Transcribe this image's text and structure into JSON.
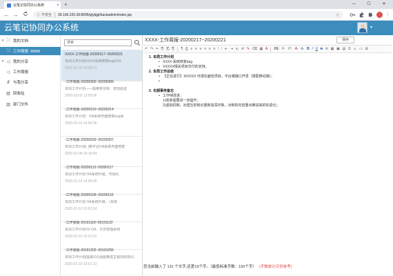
{
  "browser": {
    "tab_title": "云笔记协同办公系统",
    "tab_close": "×",
    "new_tab": "+",
    "win_min": "—",
    "win_max": "☐",
    "win_close": "✕",
    "back": "←",
    "forward": "→",
    "reload": "C",
    "info_icon": "ⓘ",
    "not_secure": "不安全",
    "url": "39.106.220.39:8095/gtybjgl/backadmin/index.jsp",
    "bookmark_star": "☆"
  },
  "app": {
    "title": "云笔记协同办公系统",
    "user_caret": "▾"
  },
  "sidebar": {
    "items": [
      {
        "exp": "▾",
        "icon": "🗀",
        "label": "我的文档"
      },
      {
        "exp": "",
        "icon": "🗀",
        "label": "工作周报",
        "selected": true
      },
      {
        "exp": "▾",
        "icon": "◁",
        "label": "我的分享"
      },
      {
        "exp": "",
        "icon": "◁",
        "label": "工作周报"
      },
      {
        "exp": "",
        "icon": "⇵",
        "label": "与我分享"
      },
      {
        "exp": "",
        "icon": "▥",
        "label": "回收站"
      },
      {
        "exp": "",
        "icon": "▥",
        "label": "部门文件"
      }
    ]
  },
  "search": {
    "placeholder": "搜索",
    "value": "搜索"
  },
  "list": [
    {
      "title": "XXXX-工作周报-20200217~20200221",
      "summary": "本周工作计划XXXX系统修复bugXXX",
      "date": "2021-01-29 14:08:21"
    },
    {
      "title": "-工作周报-20200302~20200306",
      "summary": "本周工作计划——题审核项目、增加验证",
      "date": "2020-03-02 13:50:06"
    },
    {
      "title": "-工作周报-20200210~20200214",
      "summary": "本周工作计划：OA系统界面修复bug系",
      "date": "2020-02-10 14:54:06"
    },
    {
      "title": "-工作周报-20200203~20200207",
      "summary": "本周工作计划门禁平台OA系统界面修复",
      "date": "2020-02-08 16:16:54"
    },
    {
      "title": "-工作周报-20200113~20200117",
      "summary": "本周工作计划     OA系统升级，可视化",
      "date": "2020-01-13 14:55:30"
    },
    {
      "title": "-工作周报-20200106~20200110",
      "summary": "本周工作计划     OA系统升级，（周未",
      "date": "2020-01-10 15:01:24"
    },
    {
      "title": "-工作周报-20191118~20191122",
      "summary": "本周工作计划XX     OA、文件管理系统",
      "date": "2020-01-10 15:01:21"
    },
    {
      "title": "-工作周报-20191202~20191206",
      "summary": "本周工作计划(提取XX)话题推送主题项目协同",
      "date": "2020-01-10 15:01:13"
    }
  ],
  "editor": {
    "title": "XXXX-工作周报-20200217~20200221",
    "save_label": "保存",
    "toolbar": [
      "↶",
      "↷",
      "✂",
      "⎘",
      "⎗",
      "⎘",
      "¶",
      "⎙",
      "≡",
      "≡",
      "≡",
      "≡",
      "≡",
      "≡",
      "⁞",
      "⁞",
      "⇤",
      "⇥",
      "x₂",
      "x²",
      "✎",
      "⌫",
      "▦",
      "A",
      "H1·",
      "F·",
      "rT·",
      "A·",
      "A·",
      "B",
      "I",
      "U",
      "S",
      "⊘",
      "▦",
      "▣",
      "▤",
      "Ω",
      "☺",
      "▭",
      "⊞"
    ],
    "sections": [
      {
        "num": "1.",
        "heading": "本周工作计划",
        "bullets": [
          "XXXX 系统修复bug",
          "XXXXX相关项目交付的支持。"
        ]
      },
      {
        "num": "2.",
        "heading": "本周工作总结",
        "bullets": [
          "【正在进行】对XXXX  可视化面包项目，平台端接口开发（搭配移动端）。",
          ""
        ]
      },
      {
        "num": "3.",
        "heading": "长期事务备忘",
        "bullets": [
          "工作待改进：",
          "1)效率需要进一步提升；",
          "2)虚拟机制，对遗忘的知识重新加深印象，对新的内容重点推进来的好返记；"
        ]
      }
    ]
  },
  "status": {
    "text": "您当前输入了 131 个文字,还差19个字。（最低标准字数：150个字）",
    "note": "(字数统计仅供参考)"
  },
  "colors": {
    "header": "#3c8dbc",
    "selected_list": "#dbe6f1",
    "status_note": "#d9534f"
  }
}
